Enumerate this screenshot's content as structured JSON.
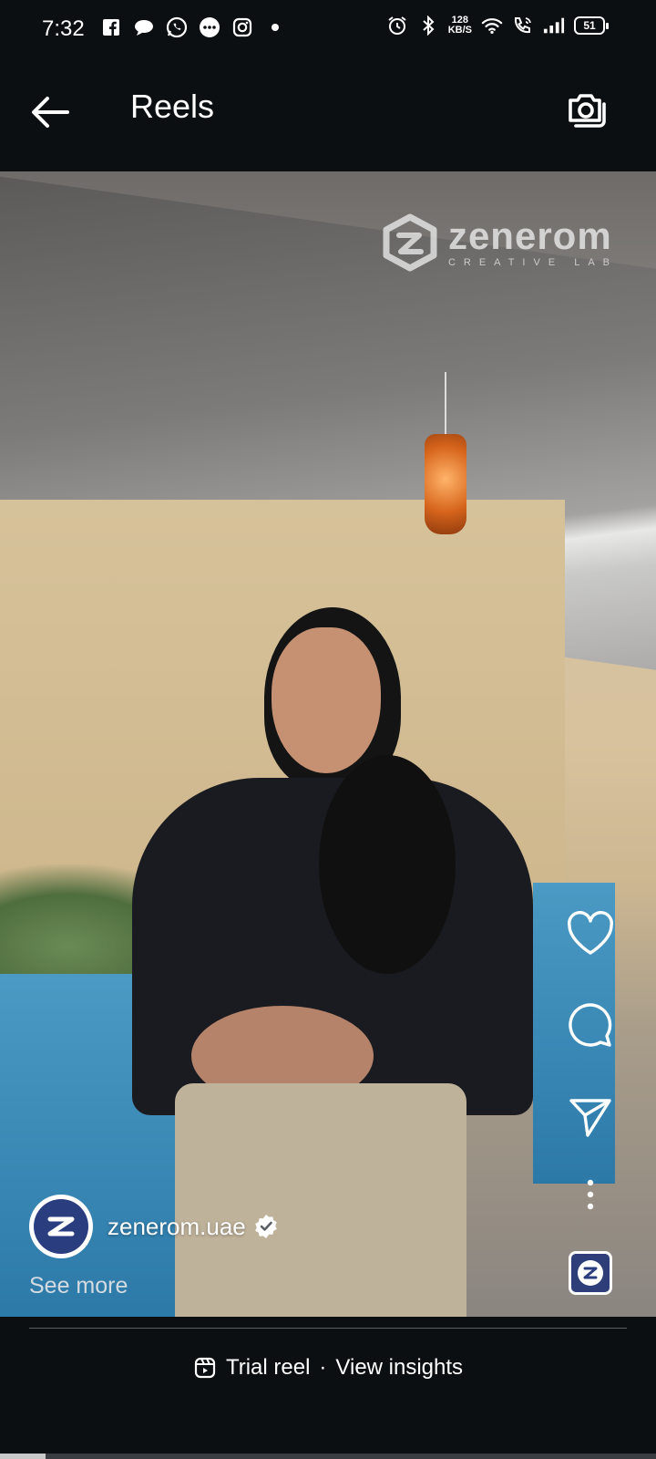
{
  "status_bar": {
    "time": "7:32",
    "net_speed_value": "128",
    "net_speed_unit": "KB/S",
    "battery": "51",
    "icons": [
      "facebook-icon",
      "chat-bubble-icon",
      "whatsapp-icon",
      "messenger-icon",
      "instagram-icon",
      "dot-icon",
      "alarm-icon",
      "bluetooth-icon",
      "wifi-icon",
      "wifi-call-icon",
      "signal-icon",
      "battery-icon"
    ]
  },
  "header": {
    "title": "Reels",
    "back_icon": "arrow-left-icon",
    "camera_icon": "camera-icon"
  },
  "video": {
    "watermark_text": "zenerom",
    "watermark_subtext": "CREATIVE LAB"
  },
  "actions": {
    "like_icon": "heart-icon",
    "comment_icon": "comment-icon",
    "share_icon": "send-icon",
    "more_icon": "more-vertical-icon",
    "audio_icon": "audio-thumbnail-icon"
  },
  "author": {
    "username": "zenerom.uae",
    "verified": true,
    "see_more": "See more"
  },
  "footer": {
    "trial_label": "Trial reel",
    "separator": "·",
    "insights_label": "View insights"
  },
  "progress": {
    "fraction": 0.07
  },
  "colors": {
    "background": "#0c0f12",
    "brand_blue": "#2a3d7f"
  }
}
